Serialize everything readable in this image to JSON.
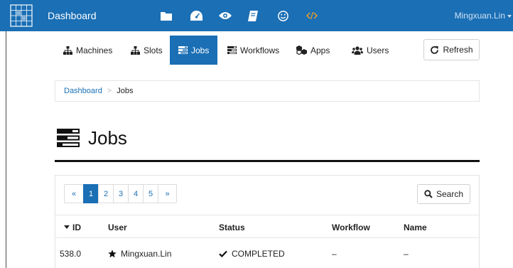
{
  "topbar": {
    "brand": "Dashboard",
    "user": "Mingxuan.Lin",
    "icons": [
      "folder-icon",
      "dashboard-icon",
      "eye-icon",
      "book-icon",
      "smile-icon",
      "code-icon"
    ],
    "colors": {
      "bar": "#1a6fb5",
      "code_icon": "#f0a020"
    }
  },
  "subnav": {
    "tabs": [
      {
        "label": "Machines",
        "icon": "sitemap-icon"
      },
      {
        "label": "Slots",
        "icon": "sitemap-icon"
      },
      {
        "label": "Jobs",
        "icon": "tasks-icon",
        "active": true
      },
      {
        "label": "Workflows",
        "icon": "tasks-icon"
      },
      {
        "label": "Apps",
        "icon": "cubes-icon"
      },
      {
        "label": "Users",
        "icon": "users-icon"
      }
    ],
    "refresh_label": "Refresh"
  },
  "breadcrumb": {
    "root": "Dashboard",
    "separator": ">",
    "current": "Jobs"
  },
  "page": {
    "title": "Jobs"
  },
  "pagination": {
    "prev": "«",
    "pages": [
      "1",
      "2",
      "3",
      "4",
      "5"
    ],
    "current": "1",
    "next": "»"
  },
  "search": {
    "label": "Search"
  },
  "table": {
    "columns": [
      "ID",
      "User",
      "Status",
      "Workflow",
      "Name"
    ],
    "sorted_column": "ID",
    "rows": [
      {
        "id": "538.0",
        "user": "Mingxuan.Lin",
        "status": "COMPLETED",
        "workflow": "–",
        "name": "–"
      }
    ]
  }
}
